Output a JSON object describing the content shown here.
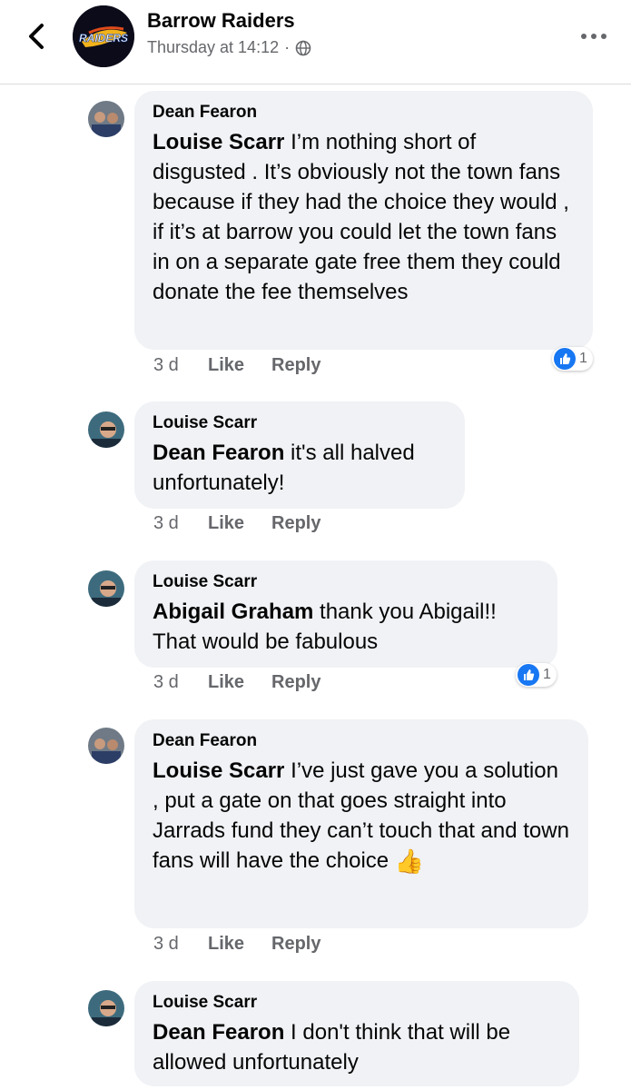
{
  "header": {
    "page_name": "Barrow Raiders",
    "post_time": "Thursday at 14:12",
    "separator": "·",
    "logo_text": "RAIDERS",
    "accent_color": "#1877f2"
  },
  "comments": [
    {
      "author": "Dean Fearon",
      "mention": "Louise Scarr",
      "text": " I’m nothing short of disgusted . It’s obviously not the town fans because if they had the choice they would , if it’s at barrow you could let the town fans in on a separate gate free them they could donate the fee themselves",
      "time": "3 d",
      "like_label": "Like",
      "reply_label": "Reply",
      "reaction_count": "1"
    },
    {
      "author": "Louise Scarr",
      "mention": "Dean Fearon",
      "text": " it's all halved unfortunately!",
      "time": "3 d",
      "like_label": "Like",
      "reply_label": "Reply"
    },
    {
      "author": "Louise Scarr",
      "mention": "Abigail Graham",
      "text": " thank you Abigail!! That would be fabulous",
      "time": "3 d",
      "like_label": "Like",
      "reply_label": "Reply",
      "reaction_count": "1"
    },
    {
      "author": "Dean Fearon",
      "mention": "Louise Scarr",
      "text": " I’ve just gave you a solution , put a gate on that goes straight into Jarrads fund they can’t touch that and town fans will have the choice",
      "emoji": "👍",
      "time": "3 d",
      "like_label": "Like",
      "reply_label": "Reply"
    },
    {
      "author": "Louise Scarr",
      "mention": "Dean Fearon",
      "text": " I don't think that will be allowed unfortunately"
    }
  ]
}
